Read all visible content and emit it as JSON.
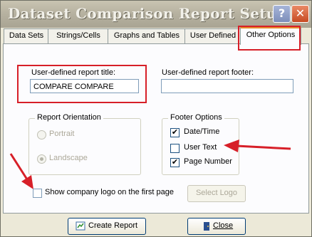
{
  "window": {
    "title": "Dataset Comparison Report Setup",
    "help_glyph": "?",
    "close_glyph": "✕"
  },
  "tabs": [
    {
      "label": "Data Sets"
    },
    {
      "label": "Strings/Cells"
    },
    {
      "label": "Graphs and Tables"
    },
    {
      "label": "User Defined"
    },
    {
      "label": "Other Options",
      "active": true
    }
  ],
  "report_title": {
    "label": "User-defined report title:",
    "value": "COMPARE COMPARE"
  },
  "report_footer": {
    "label": "User-defined report footer:",
    "value": ""
  },
  "orientation": {
    "title": "Report Orientation",
    "options": [
      {
        "label": "Portrait",
        "selected": false
      },
      {
        "label": "Landscape",
        "selected": true
      }
    ]
  },
  "footer_options": {
    "title": "Footer Options",
    "options": [
      {
        "label": "Date/Time",
        "checked": true
      },
      {
        "label": "User Text",
        "checked": false
      },
      {
        "label": "Page Number",
        "checked": true
      }
    ]
  },
  "logo": {
    "label": "Show company logo on the first page",
    "checked": false,
    "select_button": "Select Logo"
  },
  "buttons": {
    "create_label": "Create Report",
    "close_label": "Close",
    "check_glyph": "✔"
  },
  "colors": {
    "highlight": "#d71f28",
    "tab_accent": "#e68b2c",
    "dialog_bg": "#ece9d8"
  }
}
